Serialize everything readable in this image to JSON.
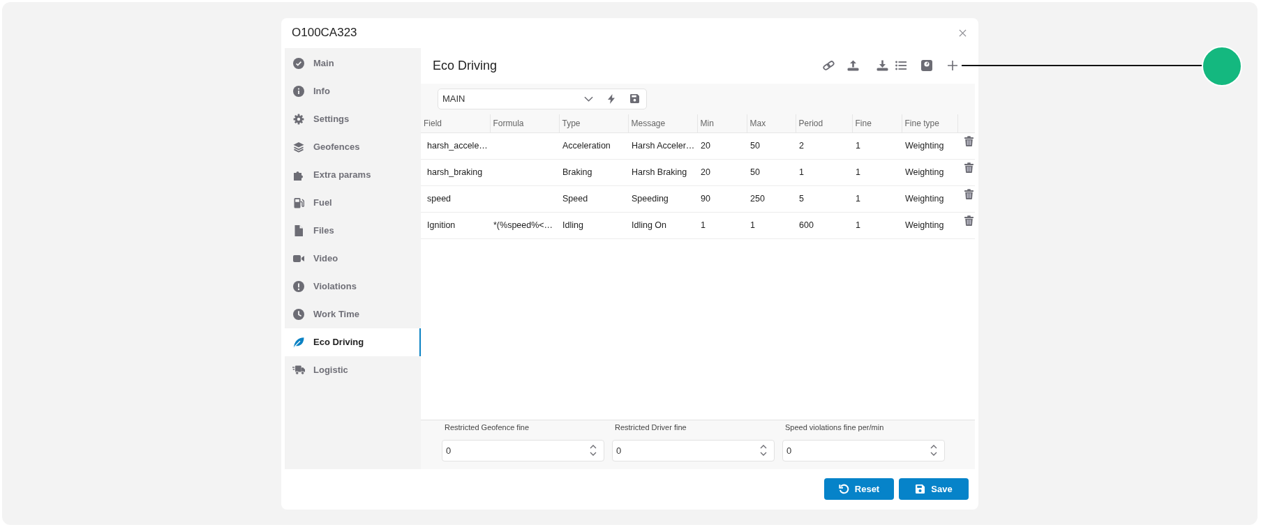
{
  "dialog": {
    "title": "O100CA323"
  },
  "sidebar": {
    "items": [
      {
        "label": "Main",
        "selected": false
      },
      {
        "label": "Info",
        "selected": false
      },
      {
        "label": "Settings",
        "selected": false
      },
      {
        "label": "Geofences",
        "selected": false
      },
      {
        "label": "Extra params",
        "selected": false
      },
      {
        "label": "Fuel",
        "selected": false
      },
      {
        "label": "Files",
        "selected": false
      },
      {
        "label": "Video",
        "selected": false
      },
      {
        "label": "Violations",
        "selected": false
      },
      {
        "label": "Work Time",
        "selected": false
      },
      {
        "label": "Eco Driving",
        "selected": true
      },
      {
        "label": "Logistic",
        "selected": false
      }
    ]
  },
  "content": {
    "title": "Eco Driving"
  },
  "filter": {
    "value": "MAIN"
  },
  "table": {
    "columns": [
      "Field",
      "Formula",
      "Type",
      "Message",
      "Min",
      "Max",
      "Period",
      "Fine",
      "Fine type"
    ],
    "rows": [
      {
        "field": "harsh_accele…",
        "type": "Acceleration",
        "message": "Harsh Acceler…",
        "min": "20",
        "max": "50",
        "period": "2",
        "fine": "1",
        "fine_type": "Weighting"
      },
      {
        "field": "harsh_braking",
        "type": "Braking",
        "message": "Harsh Braking",
        "min": "20",
        "max": "50",
        "period": "1",
        "fine": "1",
        "fine_type": "Weighting"
      },
      {
        "field": "speed",
        "type": "Speed",
        "message": "Speeding",
        "min": "90",
        "max": "250",
        "period": "5",
        "fine": "1",
        "fine_type": "Weighting"
      },
      {
        "field": "Ignition",
        "formula": "*(%speed%<…",
        "type": "Idling",
        "message": "Idling On",
        "min": "1",
        "max": "1",
        "period": "600",
        "fine": "1",
        "fine_type": "Weighting"
      }
    ]
  },
  "fines": [
    {
      "label": "Restricted Geofence fine",
      "value": "0"
    },
    {
      "label": "Restricted Driver fine",
      "value": "0"
    },
    {
      "label": "Speed violations fine per/min",
      "value": "0"
    }
  ],
  "buttons": [
    {
      "label": "Reset"
    },
    {
      "label": "Save"
    }
  ]
}
